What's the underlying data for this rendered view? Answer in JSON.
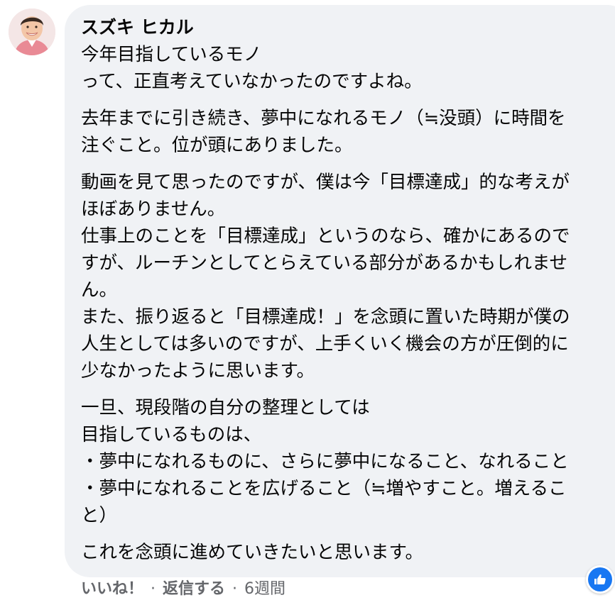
{
  "comment": {
    "author": "スズキ ヒカル",
    "paragraphs": [
      [
        "今年目指しているモノ",
        "って、正直考えていなかったのですよね。"
      ],
      [
        "去年までに引き続き、夢中になれるモノ（≒没頭）に時間を",
        "注ぐこと。位が頭にありました。"
      ],
      [
        "動画を見て思ったのですが、僕は今「目標達成」的な考えが",
        "ほぼありません。",
        "仕事上のことを「目標達成」というのなら、確かにあるので",
        "すが、ルーチンとしてとらえている部分があるかもしれませ",
        "ん。",
        "また、振り返ると「目標達成！」を念頭に置いた時期が僕の",
        "人生としては多いのですが、上手くいく機会の方が圧倒的に",
        "少なかったように思います。"
      ],
      [
        "一旦、現段階の自分の整理としては",
        "目指しているものは、",
        "・夢中になれるものに、さらに夢中になること、なれること",
        "・夢中になれることを広げること（≒増やすこと。増えるこ",
        "と）"
      ],
      [
        "これを念頭に進めていきたいと思います。"
      ]
    ]
  },
  "footer": {
    "like_label": "いいね！",
    "reply_label": "返信する",
    "time_label": "6週間"
  },
  "reaction": {
    "icon": "thumbs-up-icon",
    "color": "#1877f2"
  }
}
